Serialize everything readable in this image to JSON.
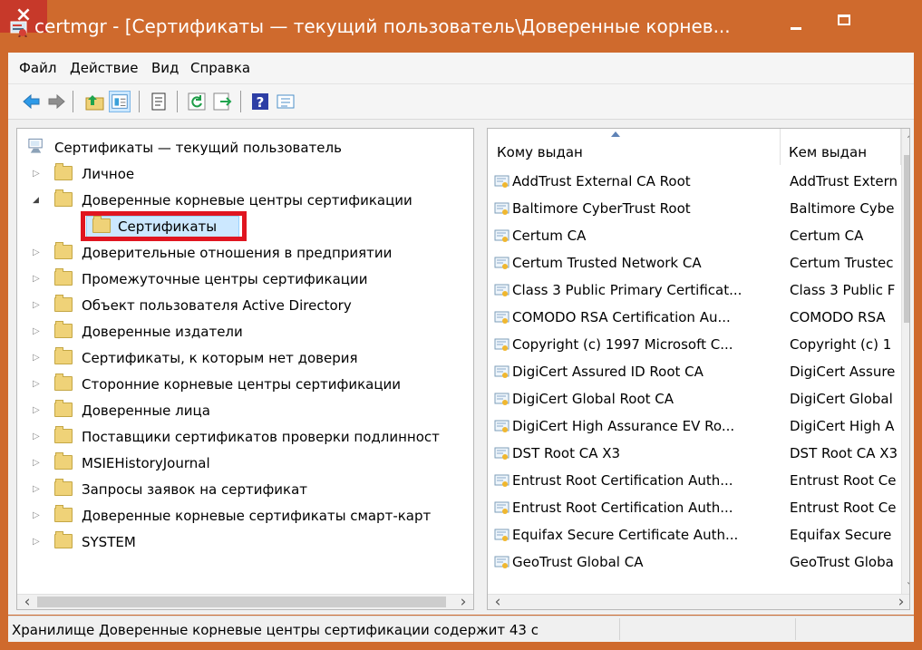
{
  "window": {
    "title": "certmgr - [Сертификаты — текущий пользователь\\Доверенные корнев...",
    "close_label": "×",
    "accent": "#cf6a2d"
  },
  "menu": {
    "items": [
      "Файл",
      "Действие",
      "Вид",
      "Справка"
    ]
  },
  "toolbar": {
    "icons": [
      "back-icon",
      "forward-icon",
      "up-folder-icon",
      "show-hide-tree-icon",
      "properties-icon",
      "refresh-icon",
      "export-list-icon",
      "help-icon",
      "view-icon"
    ]
  },
  "tree": {
    "root": "Сертификаты — текущий пользователь",
    "items": [
      "Личное",
      "Доверенные корневые центры сертификации",
      "Сертификаты",
      "Доверительные отношения в предприятии",
      "Промежуточные центры сертификации",
      "Объект пользователя Active Directory",
      "Доверенные издатели",
      "Сертификаты, к которым нет доверия",
      "Сторонние корневые центры сертификации",
      "Доверенные лица",
      "Поставщики сертификатов проверки подлинност",
      "MSIEHistoryJournal",
      "Запросы заявок на сертификат",
      "Доверенные корневые сертификаты смарт-карт",
      "SYSTEM"
    ]
  },
  "list": {
    "headers": [
      "Кому выдан",
      "Кем выдан"
    ],
    "rows": [
      {
        "issued_to": "AddTrust External CA Root",
        "issued_by": "AddTrust Extern"
      },
      {
        "issued_to": "Baltimore CyberTrust Root",
        "issued_by": "Baltimore Cybe"
      },
      {
        "issued_to": "Certum CA",
        "issued_by": "Certum CA"
      },
      {
        "issued_to": "Certum Trusted Network CA",
        "issued_by": "Certum Trustec"
      },
      {
        "issued_to": "Class 3 Public Primary Certificat...",
        "issued_by": "Class 3 Public F"
      },
      {
        "issued_to": "COMODO RSA Certification Au...",
        "issued_by": "COMODO RSA"
      },
      {
        "issued_to": "Copyright (c) 1997 Microsoft C...",
        "issued_by": "Copyright (c) 1"
      },
      {
        "issued_to": "DigiCert Assured ID Root CA",
        "issued_by": "DigiCert Assure"
      },
      {
        "issued_to": "DigiCert Global Root CA",
        "issued_by": "DigiCert Global"
      },
      {
        "issued_to": "DigiCert High Assurance EV Ro...",
        "issued_by": "DigiCert High A"
      },
      {
        "issued_to": "DST Root CA X3",
        "issued_by": "DST Root CA X3"
      },
      {
        "issued_to": "Entrust Root Certification Auth...",
        "issued_by": "Entrust Root Ce"
      },
      {
        "issued_to": "Entrust Root Certification Auth...",
        "issued_by": "Entrust Root Ce"
      },
      {
        "issued_to": "Equifax Secure Certificate Auth...",
        "issued_by": "Equifax Secure"
      },
      {
        "issued_to": "GeoTrust Global CA",
        "issued_by": "GeoTrust Globa"
      }
    ]
  },
  "status": {
    "text": "Хранилище Доверенные корневые центры сертификации содержит 43 с"
  }
}
